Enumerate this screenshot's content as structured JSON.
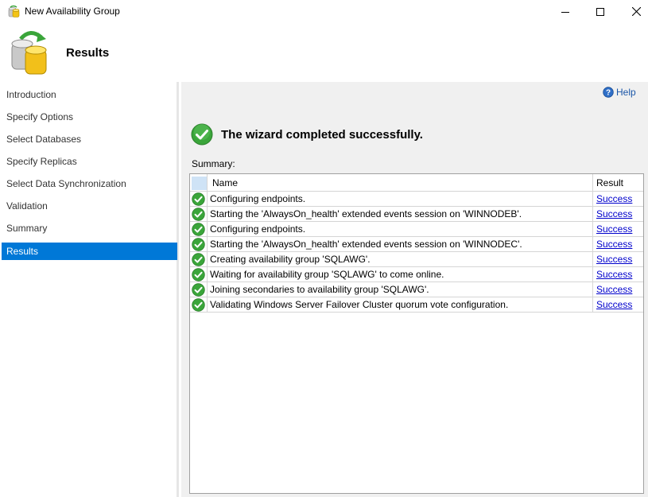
{
  "window": {
    "title": "New Availability Group"
  },
  "header": {
    "title": "Results"
  },
  "nav": {
    "items": [
      {
        "label": "Introduction",
        "active": false
      },
      {
        "label": "Specify Options",
        "active": false
      },
      {
        "label": "Select Databases",
        "active": false
      },
      {
        "label": "Specify Replicas",
        "active": false
      },
      {
        "label": "Select Data Synchronization",
        "active": false
      },
      {
        "label": "Validation",
        "active": false
      },
      {
        "label": "Summary",
        "active": false
      },
      {
        "label": "Results",
        "active": true
      }
    ]
  },
  "content": {
    "help_label": "Help",
    "status_message": "The wizard completed successfully.",
    "summary_label": "Summary:",
    "table": {
      "columns": [
        "Name",
        "Result"
      ],
      "rows": [
        {
          "name": "Configuring endpoints.",
          "result": "Success"
        },
        {
          "name": "Starting the 'AlwaysOn_health' extended events session on 'WINNODEB'.",
          "result": "Success"
        },
        {
          "name": "Configuring endpoints.",
          "result": "Success"
        },
        {
          "name": "Starting the 'AlwaysOn_health' extended events session on 'WINNODEC'.",
          "result": "Success"
        },
        {
          "name": "Creating availability group 'SQLAWG'.",
          "result": "Success"
        },
        {
          "name": "Waiting for availability group 'SQLAWG' to come online.",
          "result": "Success"
        },
        {
          "name": "Joining secondaries to availability group 'SQLAWG'.",
          "result": "Success"
        },
        {
          "name": "Validating Windows Server Failover Cluster quorum vote configuration.",
          "result": "Success"
        }
      ]
    }
  },
  "colors": {
    "accent": "#0078d7",
    "success": "#3aa53a",
    "link": "#0000cc"
  },
  "icons": {
    "app": "database-sync-icon",
    "row_status": "check-circle-icon",
    "help": "help-icon"
  }
}
